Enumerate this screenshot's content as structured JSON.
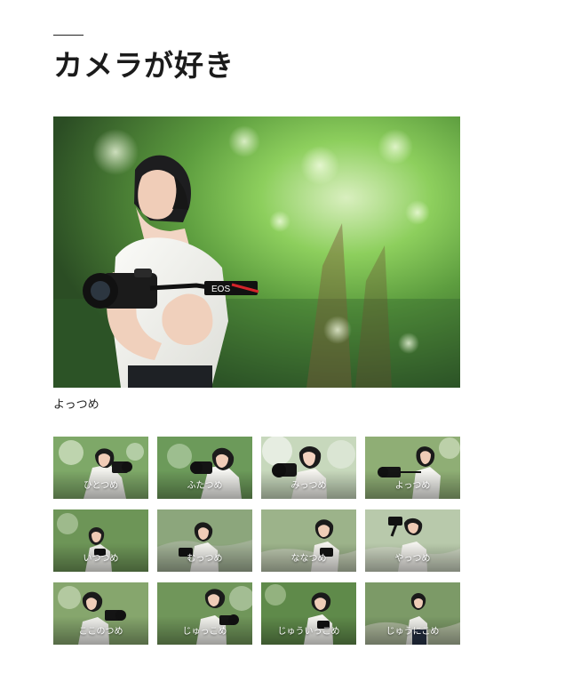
{
  "page": {
    "title": "カメラが好き"
  },
  "hero": {
    "caption": "よっつめ",
    "image_icon": "photo-icon",
    "camera_strap_text": "EOS"
  },
  "gallery": {
    "items": [
      {
        "label": "ひとつめ",
        "tone": "#7ea868"
      },
      {
        "label": "ふたつめ",
        "tone": "#6c9a5a"
      },
      {
        "label": "みっつめ",
        "tone": "#c7d8bc"
      },
      {
        "label": "よっつめ",
        "tone": "#8fae75"
      },
      {
        "label": "いつつめ",
        "tone": "#6d9557"
      },
      {
        "label": "むっつめ",
        "tone": "#8ca67c"
      },
      {
        "label": "ななつめ",
        "tone": "#9cb38a"
      },
      {
        "label": "やっつめ",
        "tone": "#b8c9ab"
      },
      {
        "label": "ここのつめ",
        "tone": "#86a66d"
      },
      {
        "label": "じゅっこめ",
        "tone": "#70965a"
      },
      {
        "label": "じゅういっこめ",
        "tone": "#5f8a4a"
      },
      {
        "label": "じゅうにこめ",
        "tone": "#7c9a67"
      }
    ]
  },
  "colors": {
    "text": "#222222",
    "background": "#ffffff",
    "foliage": "#4f8a3c"
  }
}
